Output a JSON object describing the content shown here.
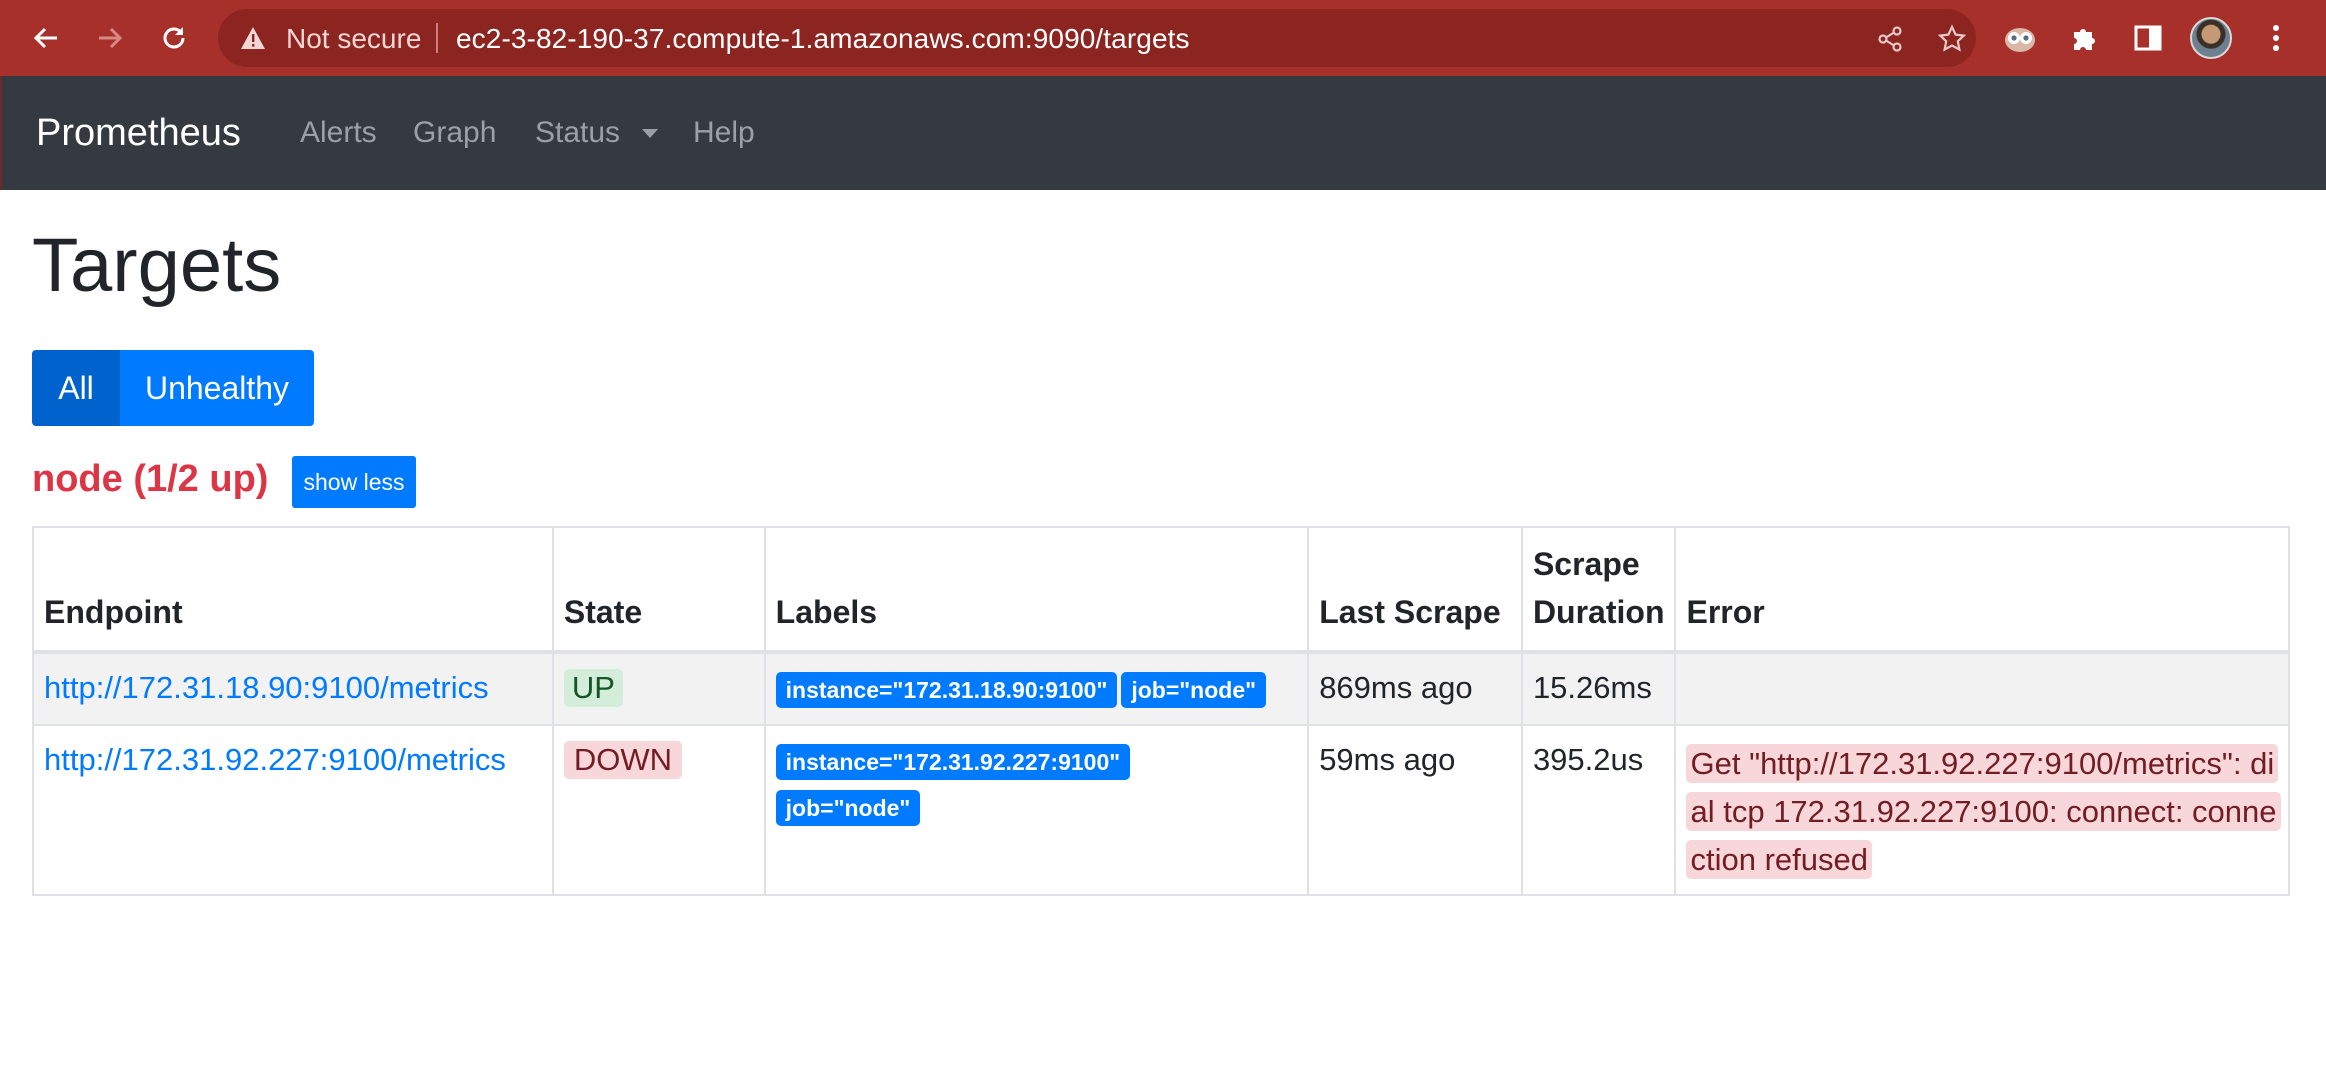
{
  "browser": {
    "security_label": "Not secure",
    "url": "ec2-3-82-190-37.compute-1.amazonaws.com:9090/targets",
    "colors": {
      "bar": "#a7302b",
      "omnibox": "#8c2520"
    }
  },
  "navbar": {
    "brand": "Prometheus",
    "links": [
      "Alerts",
      "Graph",
      "Status",
      "Help"
    ]
  },
  "page": {
    "title": "Targets",
    "filters": {
      "all": "All",
      "unhealthy": "Unhealthy"
    }
  },
  "job": {
    "title": "node (1/2 up)",
    "toggle_label": "show less"
  },
  "table": {
    "headers": {
      "endpoint": "Endpoint",
      "state": "State",
      "labels": "Labels",
      "last_scrape": "Last Scrape",
      "scrape_duration": "Scrape Duration",
      "error": "Error"
    },
    "rows": [
      {
        "endpoint": "http://172.31.18.90:9100/metrics",
        "state": "UP",
        "labels": [
          "instance=\"172.31.18.90:9100\"",
          "job=\"node\""
        ],
        "last_scrape": "869ms ago",
        "scrape_duration": "15.26ms",
        "error": ""
      },
      {
        "endpoint": "http://172.31.92.227:9100/metrics",
        "state": "DOWN",
        "labels": [
          "instance=\"172.31.92.227:9100\"",
          "job=\"node\""
        ],
        "last_scrape": "59ms ago",
        "scrape_duration": "395.2us",
        "error": "Get \"http://172.31.92.227:9100/metrics\": dial tcp 172.31.92.227:9100: connect: connection refused"
      }
    ]
  },
  "colors": {
    "primary": "#007bff",
    "danger": "#dc3545",
    "success_bg": "#d4edda",
    "danger_bg": "#f8d7da",
    "navbar_bg": "#343a40"
  }
}
